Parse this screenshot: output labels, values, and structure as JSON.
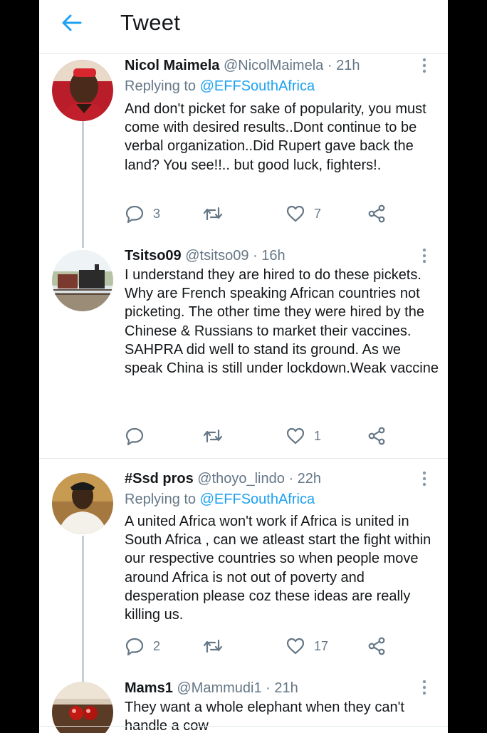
{
  "header": {
    "title": "Tweet"
  },
  "tweets": [
    {
      "name": "Nicol Maimela",
      "handle": "@NicolMaimela",
      "dot": "·",
      "time": "21h",
      "replying_label": "Replying to",
      "replying_to": "@EFFSouthAfrica",
      "text": "And don't picket for sake of popularity, you must come with desired results..Dont continue to be verbal organization..Did Rupert gave back the land? You see!!.. but good luck, fighters!.",
      "reply_count": "3",
      "retweet_count": "",
      "like_count": "7"
    },
    {
      "name": "Tsitso09",
      "handle": "@tsitso09",
      "dot": "·",
      "time": "16h",
      "text": "I understand they are hired to do these pickets. Why are French speaking African countries not picketing. The other time they were hired by the Chinese & Russians to market their vaccines.\nSAHPRA did well to stand its ground. As we speak China is still under lockdown.Weak vaccine",
      "reply_count": "",
      "retweet_count": "",
      "like_count": "1"
    },
    {
      "name": "#Ssd pros",
      "handle": "@thoyo_lindo",
      "dot": "·",
      "time": "22h",
      "replying_label": "Replying to",
      "replying_to": "@EFFSouthAfrica",
      "text": "A united Africa won't work if Africa is united in South Africa , can we atleast start the fight within our respective countries so when people move around Africa is not out of poverty and desperation please coz these ideas are really killing us.",
      "reply_count": "2",
      "retweet_count": "",
      "like_count": "17"
    },
    {
      "name": "Mams1",
      "handle": "@Mammudi1",
      "dot": "·",
      "time": "21h",
      "text": "They want a whole elephant when they can't handle a cow"
    }
  ],
  "icons": {
    "back": "arrow-left-icon",
    "more": "more-vertical-icon",
    "reply": "reply-icon",
    "retweet": "retweet-icon",
    "like": "heart-icon",
    "share": "share-icon"
  },
  "colors": {
    "accent": "#1da1f2",
    "secondary_text": "#657786",
    "thread_line": "#c4cfd6"
  }
}
